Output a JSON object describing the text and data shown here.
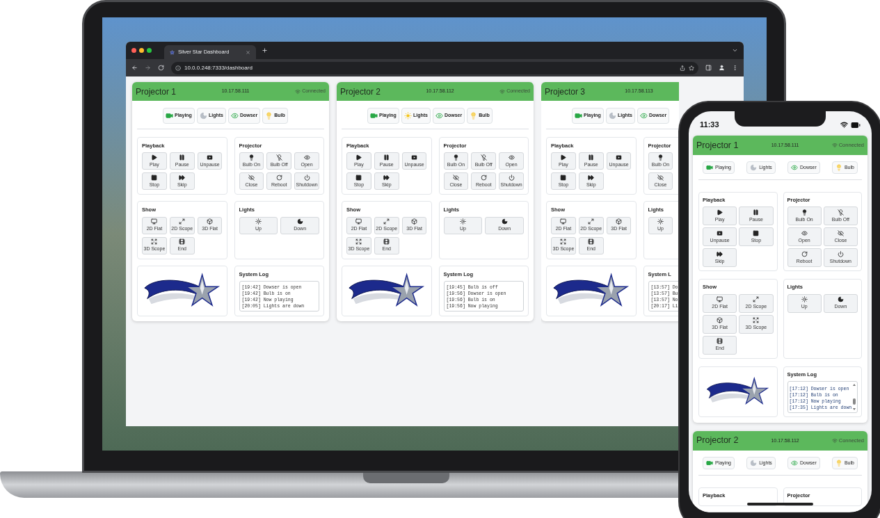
{
  "browser": {
    "tab_title": "Silver Star Dashboard",
    "url": "10.0.0.248:7333/dashboard"
  },
  "laptop_projectors": [
    {
      "name": "Projector 1",
      "ip": "10.17.58.111",
      "status": "Connected",
      "indicators": [
        {
          "kind": "playing",
          "label": "Playing",
          "on": true
        },
        {
          "kind": "lights",
          "label": "Lights",
          "on": false
        },
        {
          "kind": "dowser",
          "label": "Dowser",
          "on": true
        },
        {
          "kind": "bulb",
          "label": "Bulb",
          "on": true
        }
      ],
      "sections": [
        {
          "kind": "buttons",
          "title": "Playback",
          "rows": [
            [
              {
                "kind": "play",
                "label": "Play"
              },
              {
                "kind": "pause",
                "label": "Pause"
              },
              {
                "kind": "unpause",
                "label": "Unpause"
              }
            ],
            [
              {
                "kind": "stop",
                "label": "Stop"
              },
              {
                "kind": "skip",
                "label": "Skip"
              }
            ]
          ]
        },
        {
          "kind": "buttons",
          "title": "Projector",
          "rows": [
            [
              {
                "kind": "bulbon",
                "label": "Bulb On"
              },
              {
                "kind": "bulboff",
                "label": "Bulb Off"
              },
              {
                "kind": "open",
                "label": "Open"
              }
            ],
            [
              {
                "kind": "close",
                "label": "Close"
              },
              {
                "kind": "reboot",
                "label": "Reboot"
              },
              {
                "kind": "shutdown",
                "label": "Shutdown"
              }
            ]
          ]
        },
        {
          "kind": "buttons",
          "title": "Show",
          "rows": [
            [
              {
                "kind": "flat2d",
                "label": "2D Flat"
              },
              {
                "kind": "scope2d",
                "label": "2D Scope"
              },
              {
                "kind": "flat3d",
                "label": "3D Flat"
              }
            ],
            [
              {
                "kind": "scope3d",
                "label": "3D Scope"
              },
              {
                "kind": "end",
                "label": "End"
              }
            ]
          ]
        },
        {
          "kind": "buttons",
          "title": "Lights",
          "wide": true,
          "rows": [
            [
              {
                "kind": "up",
                "label": "Up"
              },
              {
                "kind": "down",
                "label": "Down"
              }
            ]
          ]
        },
        {
          "kind": "logo"
        },
        {
          "kind": "log",
          "title": "System Log",
          "lines": [
            "[19:42] Dowser is open",
            "[19:42] Bulb is on",
            "[19:42] Now playing",
            "[20:05] Lights are down"
          ]
        }
      ]
    },
    {
      "name": "Projector 2",
      "ip": "10.17.58.112",
      "status": "Connected",
      "indicators": [
        {
          "kind": "playing",
          "label": "Playing",
          "on": true
        },
        {
          "kind": "lights",
          "label": "Lights",
          "on": true
        },
        {
          "kind": "dowser",
          "label": "Dowser",
          "on": true
        },
        {
          "kind": "bulb",
          "label": "Bulb",
          "on": true
        }
      ],
      "sections": [
        {
          "kind": "buttons",
          "title": "Playback",
          "rows": [
            [
              {
                "kind": "play",
                "label": "Play"
              },
              {
                "kind": "pause",
                "label": "Pause"
              },
              {
                "kind": "unpause",
                "label": "Unpause"
              }
            ],
            [
              {
                "kind": "stop",
                "label": "Stop"
              },
              {
                "kind": "skip",
                "label": "Skip"
              }
            ]
          ]
        },
        {
          "kind": "buttons",
          "title": "Projector",
          "rows": [
            [
              {
                "kind": "bulbon",
                "label": "Bulb On"
              },
              {
                "kind": "bulboff",
                "label": "Bulb Off"
              },
              {
                "kind": "open",
                "label": "Open"
              }
            ],
            [
              {
                "kind": "close",
                "label": "Close"
              },
              {
                "kind": "reboot",
                "label": "Reboot"
              },
              {
                "kind": "shutdown",
                "label": "Shutdown"
              }
            ]
          ]
        },
        {
          "kind": "buttons",
          "title": "Show",
          "rows": [
            [
              {
                "kind": "flat2d",
                "label": "2D Flat"
              },
              {
                "kind": "scope2d",
                "label": "2D Scope"
              },
              {
                "kind": "flat3d",
                "label": "3D Flat"
              }
            ],
            [
              {
                "kind": "scope3d",
                "label": "3D Scope"
              },
              {
                "kind": "end",
                "label": "End"
              }
            ]
          ]
        },
        {
          "kind": "buttons",
          "title": "Lights",
          "wide": true,
          "rows": [
            [
              {
                "kind": "up",
                "label": "Up"
              },
              {
                "kind": "down",
                "label": "Down"
              }
            ]
          ]
        },
        {
          "kind": "logo"
        },
        {
          "kind": "log",
          "title": "System Log",
          "lines": [
            "[19:45] Bulb is off",
            "[19:56] Dowser is open",
            "[19:56] Bulb is on",
            "[19:56] Now playing"
          ]
        }
      ]
    },
    {
      "name": "Projector 3",
      "ip": "10.17.58.113",
      "indicators": [
        {
          "kind": "playing",
          "label": "Playing",
          "on": true
        },
        {
          "kind": "lights",
          "label": "Lights",
          "on": false
        },
        {
          "kind": "dowser",
          "label": "Dowser",
          "on": true
        }
      ],
      "sections": [
        {
          "kind": "buttons",
          "title": "Playback",
          "rows": [
            [
              {
                "kind": "play",
                "label": "Play"
              },
              {
                "kind": "pause",
                "label": "Pause"
              },
              {
                "kind": "unpause",
                "label": "Unpause"
              }
            ],
            [
              {
                "kind": "stop",
                "label": "Stop"
              },
              {
                "kind": "skip",
                "label": "Skip"
              }
            ]
          ]
        },
        {
          "kind": "buttons",
          "title": "Projector",
          "rows": [
            [
              {
                "kind": "bulbon",
                "label": "Bulb On"
              }
            ],
            [
              {
                "kind": "close",
                "label": "Close"
              }
            ]
          ]
        },
        {
          "kind": "buttons",
          "title": "Show",
          "rows": [
            [
              {
                "kind": "flat2d",
                "label": "2D Flat"
              },
              {
                "kind": "scope2d",
                "label": "2D Scope"
              },
              {
                "kind": "flat3d",
                "label": "3D Flat"
              }
            ],
            [
              {
                "kind": "scope3d",
                "label": "3D Scope"
              },
              {
                "kind": "end",
                "label": "End"
              }
            ]
          ]
        },
        {
          "kind": "buttons",
          "title": "Lights",
          "rows": [
            [
              {
                "kind": "up",
                "label": "Up"
              }
            ]
          ]
        },
        {
          "kind": "logo"
        },
        {
          "kind": "log",
          "title": "System L",
          "lines": [
            "[13:57] Do",
            "[13:57] Bu",
            "[13:57] No",
            "[20:17] Li"
          ]
        }
      ]
    }
  ],
  "phone": {
    "time": "11:33",
    "projectors": [
      {
        "name": "Projector 1",
        "ip": "10.17.58.111",
        "status": "Connected",
        "indicators": [
          {
            "kind": "playing",
            "label": "Playing",
            "on": true
          },
          {
            "kind": "lights",
            "label": "Lights",
            "on": false
          },
          {
            "kind": "dowser",
            "label": "Dowser",
            "on": true
          },
          {
            "kind": "bulb",
            "label": "Bulb",
            "on": true
          }
        ],
        "sections": [
          {
            "kind": "buttons",
            "title": "Playback",
            "rows": [
              [
                {
                  "kind": "play",
                  "label": "Play"
                },
                {
                  "kind": "pause",
                  "label": "Pause"
                }
              ],
              [
                {
                  "kind": "unpause",
                  "label": "Unpause"
                },
                {
                  "kind": "stop",
                  "label": "Stop"
                }
              ],
              [
                {
                  "kind": "skip",
                  "label": "Skip"
                }
              ]
            ]
          },
          {
            "kind": "buttons",
            "title": "Projector",
            "rows": [
              [
                {
                  "kind": "bulbon",
                  "label": "Bulb On"
                },
                {
                  "kind": "bulboff",
                  "label": "Bulb Off"
                }
              ],
              [
                {
                  "kind": "open",
                  "label": "Open"
                },
                {
                  "kind": "close",
                  "label": "Close"
                }
              ],
              [
                {
                  "kind": "reboot",
                  "label": "Reboot"
                },
                {
                  "kind": "shutdown",
                  "label": "Shutdown"
                }
              ]
            ]
          },
          {
            "kind": "buttons",
            "title": "Show",
            "rows": [
              [
                {
                  "kind": "flat2d",
                  "label": "2D Flat"
                },
                {
                  "kind": "scope2d",
                  "label": "2D Scope"
                }
              ],
              [
                {
                  "kind": "flat3d",
                  "label": "3D Flat"
                },
                {
                  "kind": "scope3d",
                  "label": "3D Scope"
                }
              ],
              [
                {
                  "kind": "end",
                  "label": "End"
                }
              ]
            ]
          },
          {
            "kind": "buttons",
            "title": "Lights",
            "rows": [
              [
                {
                  "kind": "up",
                  "label": "Up"
                },
                {
                  "kind": "down",
                  "label": "Down"
                }
              ]
            ]
          },
          {
            "kind": "logo"
          },
          {
            "kind": "log",
            "title": "System Log",
            "scroll": true,
            "lines": [
              "[17:12] Dowser is open",
              "[17:12] Bulb is on",
              "[17:12] Now playing",
              "[17:35] Lights are down"
            ]
          }
        ]
      },
      {
        "name": "Projector 2",
        "ip": "10.17.58.112",
        "status": "Connected",
        "indicators": [
          {
            "kind": "playing",
            "label": "Playing",
            "on": true
          },
          {
            "kind": "lights",
            "label": "Lights",
            "on": false
          },
          {
            "kind": "dowser",
            "label": "Dowser",
            "on": true
          },
          {
            "kind": "bulb",
            "label": "Bulb",
            "on": true
          }
        ],
        "sections": [
          {
            "kind": "buttons",
            "title": "Playback"
          },
          {
            "kind": "buttons",
            "title": "Projector"
          }
        ]
      }
    ]
  }
}
